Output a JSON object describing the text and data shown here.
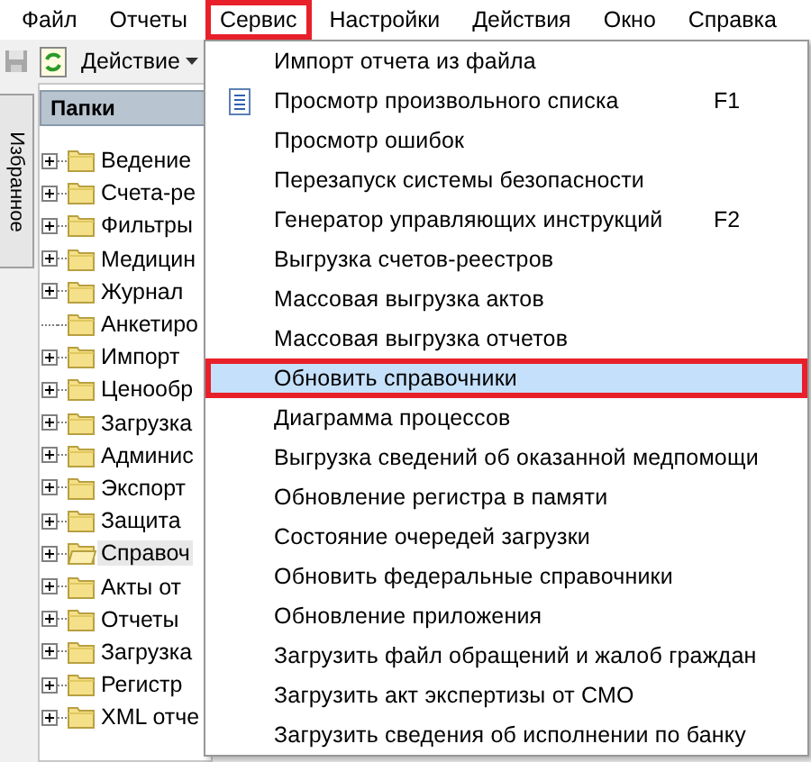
{
  "menubar": [
    {
      "label": "Файл",
      "selected": false
    },
    {
      "label": "Отчеты",
      "selected": false
    },
    {
      "label": "Сервис",
      "selected": true
    },
    {
      "label": "Настройки",
      "selected": false
    },
    {
      "label": "Действия",
      "selected": false
    },
    {
      "label": "Окно",
      "selected": false
    },
    {
      "label": "Справка",
      "selected": false
    }
  ],
  "toolbar": {
    "action_button": "Действие"
  },
  "side_tab": "Избранное",
  "folders": {
    "title": "Папки",
    "items": [
      {
        "label": "Ведение",
        "expandable": true,
        "selected": false
      },
      {
        "label": "Счета-ре",
        "expandable": true,
        "selected": false
      },
      {
        "label": "Фильтры",
        "expandable": true,
        "selected": false
      },
      {
        "label": "Медицин",
        "expandable": true,
        "selected": false
      },
      {
        "label": "Журнал",
        "expandable": true,
        "selected": false
      },
      {
        "label": "Анкетиро",
        "expandable": false,
        "selected": false
      },
      {
        "label": "Импорт",
        "expandable": true,
        "selected": false
      },
      {
        "label": "Ценообр",
        "expandable": true,
        "selected": false
      },
      {
        "label": "Загрузка",
        "expandable": true,
        "selected": false
      },
      {
        "label": "Админис",
        "expandable": true,
        "selected": false
      },
      {
        "label": "Экспорт",
        "expandable": true,
        "selected": false
      },
      {
        "label": "Защита",
        "expandable": true,
        "selected": false
      },
      {
        "label": "Справоч",
        "expandable": true,
        "selected": true
      },
      {
        "label": "Акты от",
        "expandable": true,
        "selected": false
      },
      {
        "label": "Отчеты",
        "expandable": true,
        "selected": false
      },
      {
        "label": "Загрузка",
        "expandable": true,
        "selected": false
      },
      {
        "label": "Регистр",
        "expandable": true,
        "selected": false
      },
      {
        "label": "XML отче",
        "expandable": true,
        "selected": false
      }
    ]
  },
  "menu": [
    {
      "label": "Импорт отчета из файла",
      "selected": false
    },
    {
      "label": "Просмотр произвольного списка",
      "shortcut": "F1",
      "has_icon": true,
      "selected": false
    },
    {
      "label": "Просмотр ошибок",
      "selected": false
    },
    {
      "label": "Перезапуск системы безопасности",
      "selected": false
    },
    {
      "label": "Генератор управляющих инструкций",
      "shortcut": "F2",
      "selected": false
    },
    {
      "label": "Выгрузка счетов-реестров",
      "selected": false
    },
    {
      "label": "Массовая выгрузка актов",
      "selected": false
    },
    {
      "label": "Массовая выгрузка отчетов",
      "selected": false
    },
    {
      "label": "Обновить справочники",
      "selected": true
    },
    {
      "label": "Диаграмма процессов",
      "selected": false
    },
    {
      "label": "Выгрузка сведений об оказанной медпомощи",
      "selected": false
    },
    {
      "label": "Обновление регистра в памяти",
      "selected": false
    },
    {
      "label": "Состояние очередей загрузки",
      "selected": false
    },
    {
      "label": "Обновить федеральные справочники",
      "selected": false
    },
    {
      "label": "Обновление приложения",
      "selected": false
    },
    {
      "label": "Загрузить файл обращений и жалоб граждан",
      "selected": false
    },
    {
      "label": "Загрузить акт экспертизы от СМО",
      "selected": false
    },
    {
      "label": "Загрузить сведения об исполнении по банку",
      "selected": false
    }
  ]
}
